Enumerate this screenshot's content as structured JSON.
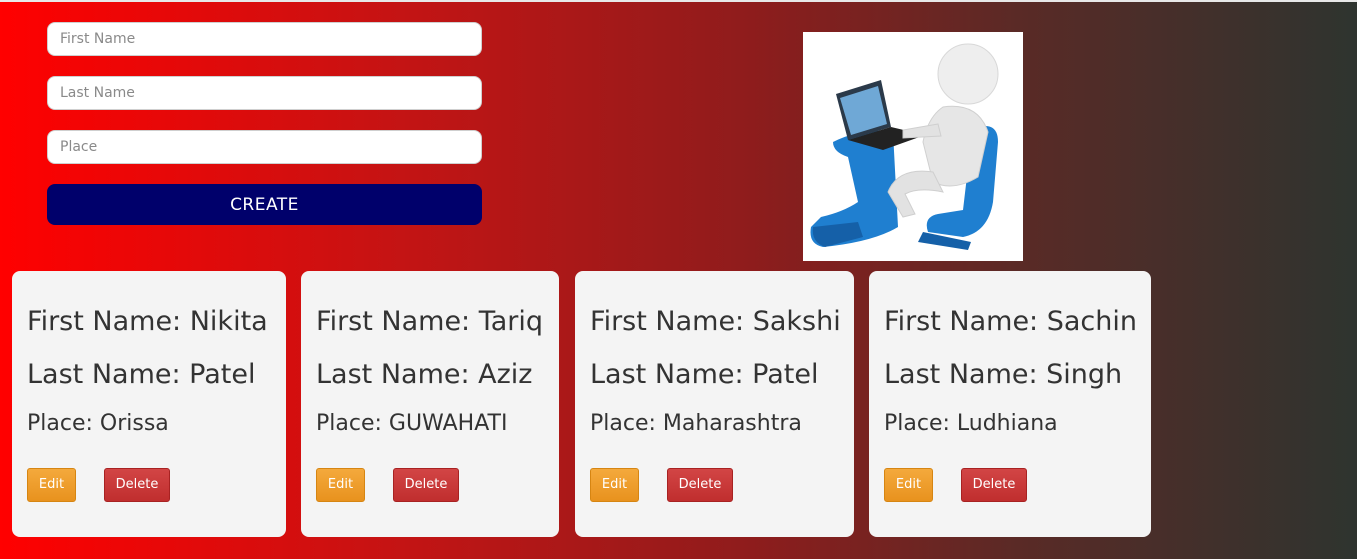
{
  "form": {
    "first_name_placeholder": "First Name",
    "last_name_placeholder": "Last Name",
    "place_placeholder": "Place",
    "create_label": "CREATE"
  },
  "cards": [
    {
      "first": "First Name: Nikita",
      "last": "Last Name: Patel",
      "place": "Place: Orissa",
      "edit": "Edit",
      "delete": "Delete"
    },
    {
      "first": "First Name: Tariq",
      "last": "Last Name: Aziz",
      "place": "Place: GUWAHATI",
      "edit": "Edit",
      "delete": "Delete"
    },
    {
      "first": "First Name: Sakshi",
      "last": "Last Name: Patel",
      "place": "Place: Maharashtra",
      "edit": "Edit",
      "delete": "Delete"
    },
    {
      "first": "First Name: Sachin",
      "last": "Last Name: Singh",
      "place": "Place: Ludhiana",
      "edit": "Edit",
      "delete": "Delete"
    }
  ],
  "colors": {
    "create_button": "#00006b",
    "edit_button": "#f0a030",
    "delete_button": "#c83434",
    "card_background": "#f4f4f4"
  },
  "illustration": {
    "icon": "person-at-laptop-icon"
  }
}
